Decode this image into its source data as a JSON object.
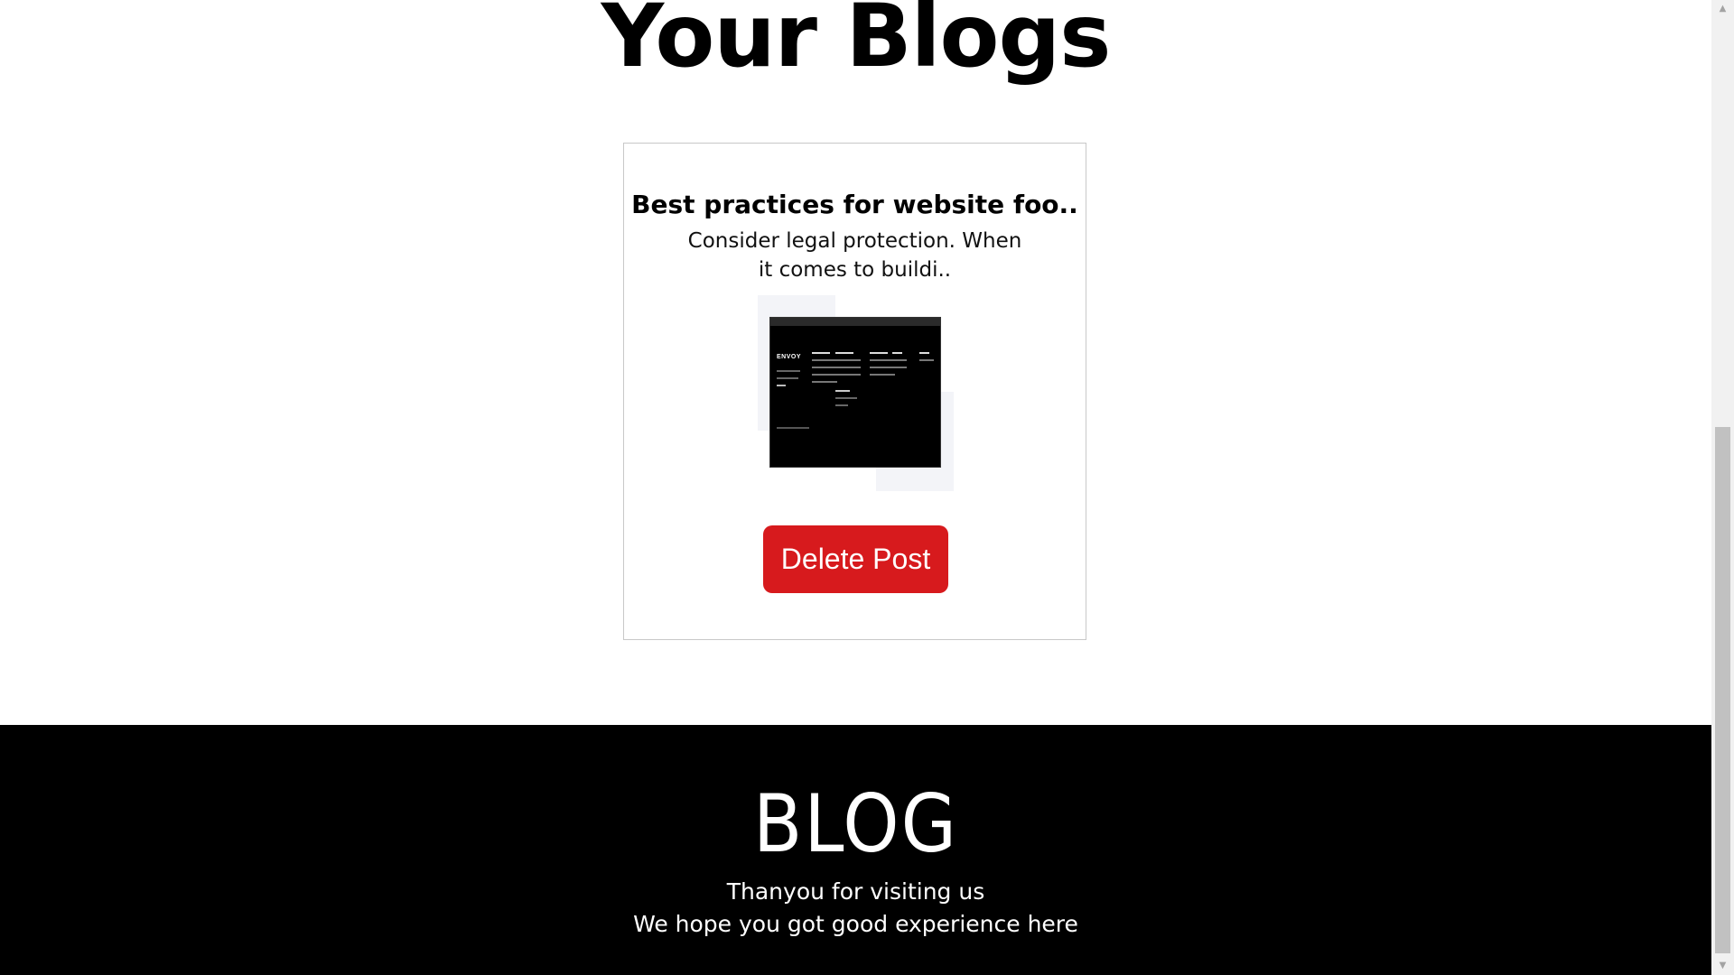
{
  "page": {
    "title": "Your Blogs"
  },
  "posts": [
    {
      "title": "Best practices for website foo..",
      "excerpt": "Consider legal protection. When it comes to buildi..",
      "thumbnail": {
        "logo_text": "ENVOY"
      },
      "delete_label": "Delete Post"
    }
  ],
  "footer": {
    "brand": "BLOG",
    "line1": "Thanyou for visiting us",
    "line2": "We hope you got good experience here"
  },
  "colors": {
    "delete_button": "#d71a1d",
    "footer_bg": "#000000",
    "page_bg": "#ffffff"
  },
  "icons": {
    "scroll_up": "triangle-up-icon",
    "scroll_down": "triangle-down-icon"
  }
}
